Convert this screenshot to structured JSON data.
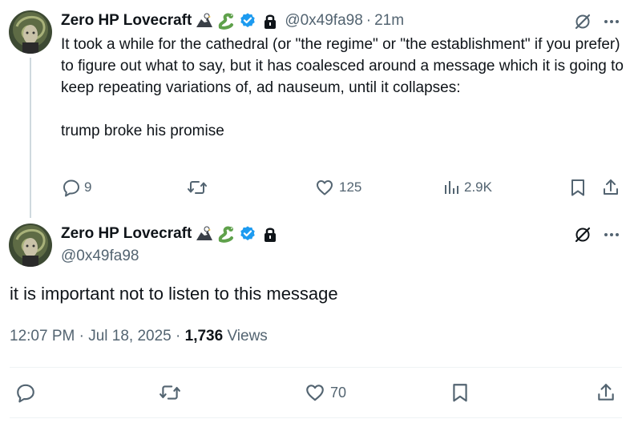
{
  "reply": {
    "author_name": "Zero HP Lovecraft",
    "handle": "@0x49fa98",
    "separator": "·",
    "time": "21m",
    "text": "It took a while for the cathedral (or \"the regime\" or \"the establishment\" if you prefer) to figure out what to say, but it has coalesced around a message which it is going to keep repeating variations of, ad nauseum, until it collapses:\n\ntrump broke his promise",
    "replies": "9",
    "reposts": "",
    "likes": "125",
    "views": "2.9K"
  },
  "main": {
    "author_name": "Zero HP Lovecraft",
    "handle": "@0x49fa98",
    "text": "it is important not to listen to this message",
    "timestamp": "12:07 PM · Jul 18, 2025",
    "dot": "·",
    "views_count": "1,736",
    "views_label": "Views",
    "likes": "70"
  },
  "icons": {
    "name_badges": [
      "eagle-icon",
      "snake-icon",
      "verified-badge-icon",
      "lock-icon"
    ],
    "actions": [
      "reply-icon",
      "repost-icon",
      "like-icon",
      "views-icon",
      "bookmark-icon",
      "share-icon"
    ],
    "top": [
      "grok-icon",
      "more-icon"
    ]
  },
  "colors": {
    "text": "#0f1419",
    "secondary": "#536471",
    "verified": "#1d9bf0",
    "thread_line": "#cfd9de"
  }
}
